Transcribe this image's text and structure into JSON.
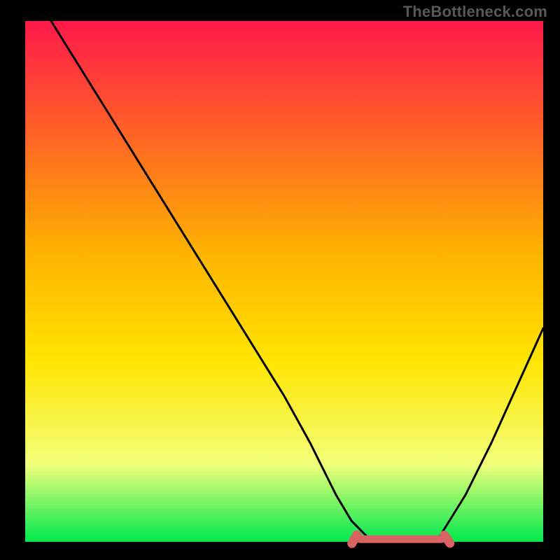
{
  "watermark": "TheBottleneck.com",
  "colors": {
    "gradient_top": "#ff194a",
    "gradient_mid": "#ffd600",
    "gradient_bottom": "#00e84e",
    "curve": "#000000",
    "flat_marker": "#d96262",
    "frame": "#000000"
  },
  "chart_data": {
    "type": "line",
    "title": "",
    "xlabel": "",
    "ylabel": "",
    "xlim": [
      0,
      100
    ],
    "ylim": [
      0,
      100
    ],
    "grid": false,
    "series": [
      {
        "name": "bottleneck-curve",
        "x": [
          5,
          10,
          15,
          20,
          25,
          30,
          35,
          40,
          45,
          50,
          55,
          60,
          63,
          66,
          70,
          75,
          80,
          85,
          90,
          95,
          100
        ],
        "y": [
          100,
          92,
          84,
          76,
          68,
          60,
          52,
          44,
          36,
          28,
          19,
          9,
          4,
          1,
          0,
          0,
          1,
          9,
          19,
          30,
          41
        ]
      }
    ],
    "flat_segment": {
      "x_start": 63,
      "x_end": 82,
      "y": 0.5
    }
  }
}
